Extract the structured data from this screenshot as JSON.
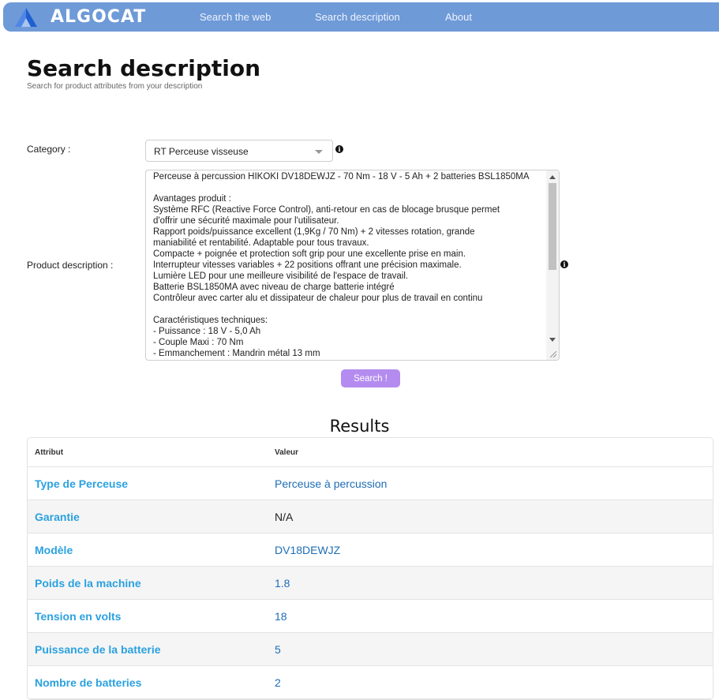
{
  "navbar": {
    "brand": "ALGOCAT",
    "links": [
      "Search the web",
      "Search description",
      "About"
    ]
  },
  "page": {
    "title": "Search description",
    "subtitle": "Search for product attributes from your description"
  },
  "form": {
    "category_label": "Category :",
    "category_value": "RT Perceuse visseuse",
    "description_label": "Product description :",
    "description_lines": [
      "Perceuse à percussion HIKOKI DV18DEWJZ - 70 Nm - 18 V - 5 Ah + 2 batteries BSL1850MA",
      "",
      "Avantages produit :",
      "Système RFC (Reactive Force Control), anti-retour en cas de blocage brusque permet",
      "d'offrir une sécurité maximale pour l'utilisateur.",
      "Rapport poids/puissance excellent (1,9Kg / 70 Nm) + 2 vitesses rotation, grande",
      "maniabilité et rentabilité. Adaptable pour tous travaux.",
      "Compacte + poignée et protection soft grip pour une excellente prise en main.",
      "Interrupteur vitesses variables + 22 positions offrant une précision maximale.",
      "Lumière LED pour une meilleure visibilité de l'espace de travail.",
      "Batterie BSL1850MA avec niveau de charge batterie intégré",
      "Contrôleur avec carter alu et dissipateur de chaleur pour plus de travail en continu",
      "",
      "Caractéristiques techniques:",
      "- Puissance : 18 V - 5,0 Ah",
      "- Couple Maxi : 70 Nm",
      "- Emmanchement : Mandrin métal 13 mm"
    ],
    "search_button": "Search !",
    "info_glyph": "i"
  },
  "results": {
    "title": "Results",
    "headers": [
      "Attribut",
      "Valeur"
    ],
    "rows": [
      {
        "attr": "Type de Perceuse",
        "value": "Perceuse à percussion"
      },
      {
        "attr": "Garantie",
        "value": "N/A"
      },
      {
        "attr": "Modèle",
        "value": "DV18DEWJZ"
      },
      {
        "attr": "Poids de la machine",
        "value": "1.8"
      },
      {
        "attr": "Tension en volts",
        "value": "18"
      },
      {
        "attr": "Puissance de la batterie",
        "value": "5"
      },
      {
        "attr": "Nombre de batteries",
        "value": "2"
      }
    ]
  },
  "colors": {
    "navbar": "#6f9ad8",
    "button": "#b48cf0",
    "attribute_text": "#2aa1e0",
    "value_text": "#1e6db5"
  }
}
